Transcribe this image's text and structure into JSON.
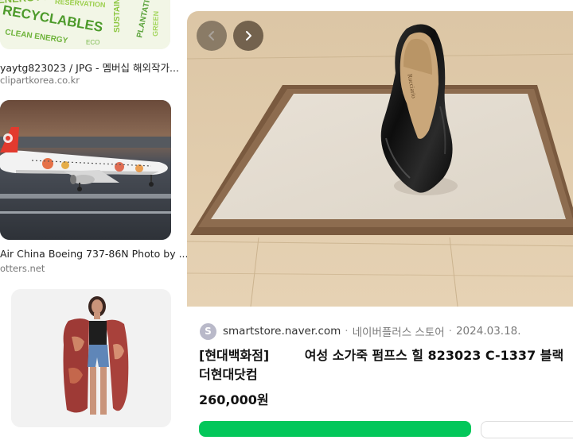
{
  "left_results": [
    {
      "caption": "yaytg823023 / JPG - 멤버십 해외작가...",
      "source": "clipartkorea.co.kr",
      "thumb_text": "RECYCLABLES"
    },
    {
      "caption": "Air China Boeing 737-86N Photo by ...",
      "source": "otters.net"
    },
    {
      "caption": "",
      "source": ""
    }
  ],
  "main_result": {
    "favicon_letter": "S",
    "domain": "smartstore.naver.com",
    "separator": "·",
    "store": "네이버플러스 스토어",
    "date": "2024.03.18.",
    "title_line1": "[현대백화점]        여성 소가죽 펌프스 힐 823023 C-1337 블랙",
    "title_line2": "더현대닷컴",
    "price": "260,000원",
    "shoe_brand": "Rucciario"
  },
  "colors": {
    "accent_green": "#03c75a",
    "favicon_bg": "#b9b9c9"
  },
  "icons": [
    "chevron-left-icon",
    "chevron-right-icon"
  ]
}
